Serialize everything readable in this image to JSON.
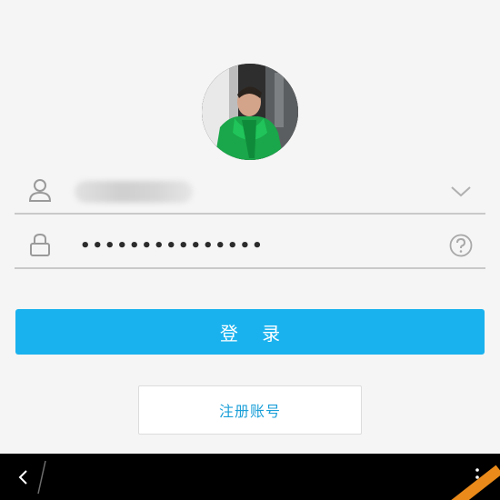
{
  "profile": {
    "avatar_icon": "user-photo"
  },
  "username_field": {
    "value": "",
    "lead_icon": "person-icon",
    "trail_icon": "chevron-down-icon"
  },
  "password_field": {
    "value": "•••••••••••••••",
    "lead_icon": "lock-icon",
    "trail_icon": "help-icon"
  },
  "buttons": {
    "login_label": "登 录",
    "register_label": "注册账号"
  },
  "colors": {
    "accent": "#1ab2ee",
    "link": "#1a9fd8",
    "nav_bar": "#000000",
    "background": "#f5f5f5"
  },
  "nav": {
    "back_icon": "back-icon",
    "more_icon": "more-vertical-icon"
  }
}
